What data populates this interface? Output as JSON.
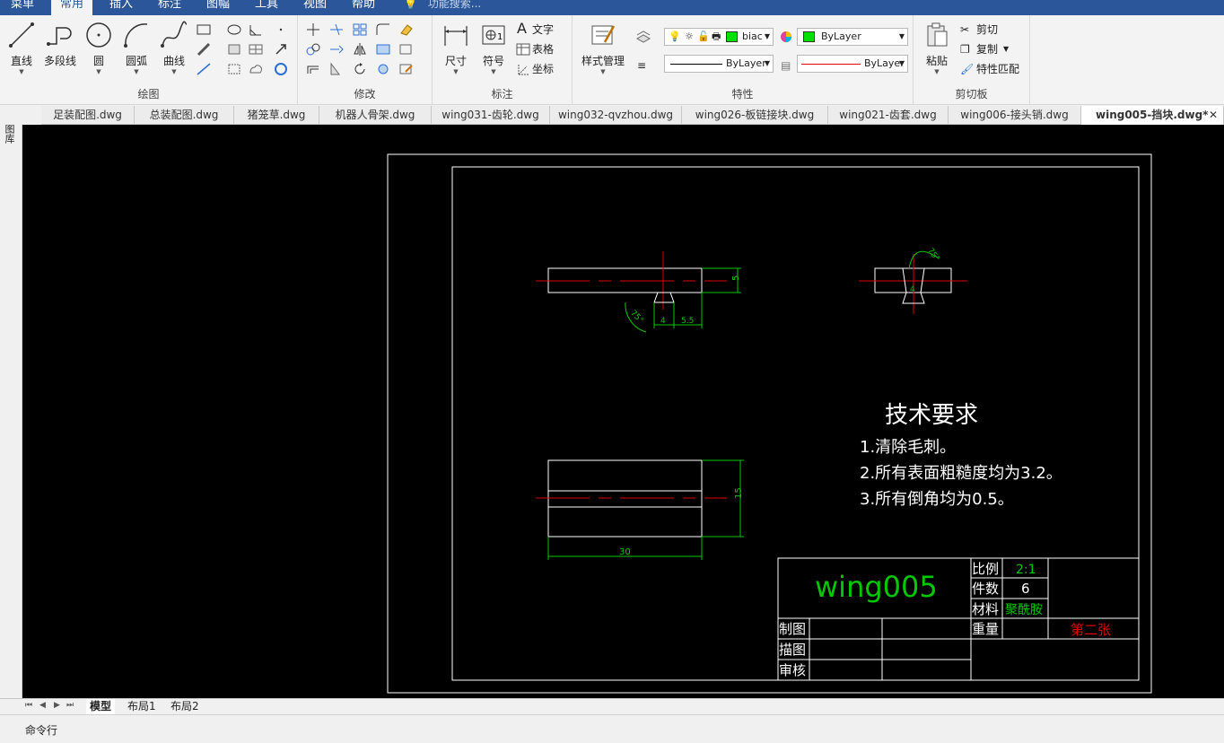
{
  "menu": {
    "items": [
      "菜单",
      "常用",
      "插入",
      "标注",
      "图幅",
      "工具",
      "视图",
      "帮助"
    ],
    "active_index": 1,
    "search_placeholder": "功能搜索..."
  },
  "ribbon": {
    "draw": {
      "label": "绘图",
      "line": "直线",
      "polyline": "多段线",
      "circle": "圆",
      "arc": "圆弧",
      "curve": "曲线"
    },
    "modify": {
      "label": "修改"
    },
    "annotate": {
      "label": "标注",
      "dimension": "尺寸",
      "symbol": "符号",
      "text": "文字",
      "table": "表格",
      "coordinate": "坐标"
    },
    "properties": {
      "label": "特性",
      "style_manager": "样式管理",
      "layer_value": "biac",
      "color_value": "ByLayer",
      "linetype_value": "ByLayer",
      "lineweight_value": "ByLayer"
    },
    "clipboard": {
      "label": "剪切板",
      "paste": "粘贴",
      "cut": "剪切",
      "copy": "复制",
      "match": "特性匹配"
    }
  },
  "tabs": [
    "足装配图.dwg",
    "总装配图.dwg",
    "猪笼草.dwg",
    "机器人骨架.dwg",
    "wing031-齿轮.dwg",
    "wing032-qvzhou.dwg",
    "wing026-板链接块.dwg",
    "wing021-齿套.dwg",
    "wing006-接头销.dwg",
    "wing005-挡块.dwg*"
  ],
  "active_tab_index": 9,
  "left_toolbar_label": "图库",
  "drawing": {
    "dims": {
      "top_height": "5",
      "top_width1": "4",
      "top_width2": "5.5",
      "top_angle": "75°",
      "right_angle": "75°",
      "right_width": "4",
      "bottom_height": "15",
      "bottom_width": "30"
    },
    "tech_title": "技术要求",
    "tech_items": [
      "1.清除毛刺。",
      "2.所有表面粗糙度均为3.2。",
      "3.所有倒角均为0.5。"
    ],
    "title_block": {
      "part_name": "wing005",
      "scale_label": "比例",
      "scale_value": "2:1",
      "qty_label": "件数",
      "qty_value": "6",
      "material_label": "材料",
      "material_value": "聚酰胺",
      "weight_label": "重量",
      "sheet_label": "第二张",
      "draw_label": "制图",
      "trace_label": "描图",
      "review_label": "审核"
    },
    "colors": {
      "outline": "#ffffff",
      "centerline": "#ff0000",
      "dimension": "#00c800",
      "background": "#000000"
    }
  },
  "layout_tabs": [
    "模型",
    "布局1",
    "布局2"
  ],
  "active_layout_index": 0,
  "command_label": "命令行"
}
